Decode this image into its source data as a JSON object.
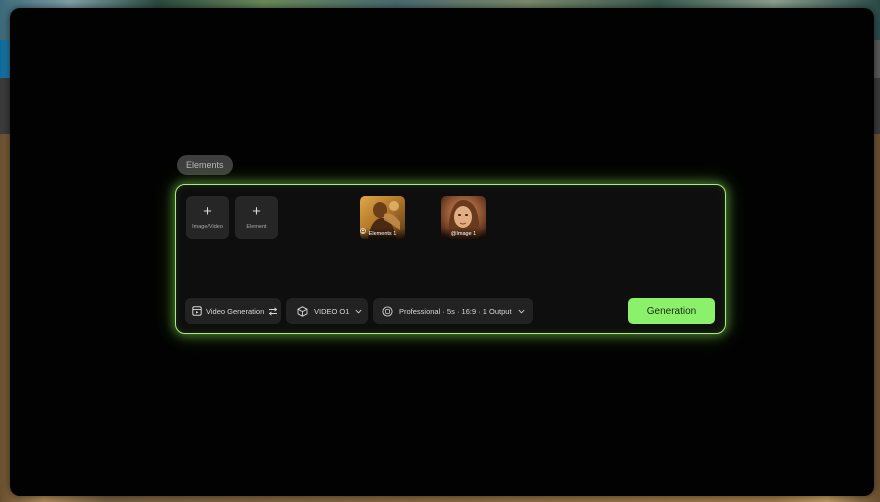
{
  "tag": {
    "label": "Elements"
  },
  "uploads": [
    {
      "label": "Image/Video",
      "icon": "plus-icon"
    },
    {
      "label": "Element",
      "icon": "plus-icon"
    }
  ],
  "thumbnails": [
    {
      "label": "Elements 1",
      "icon": "person-badge-icon"
    },
    {
      "label": "@Image 1"
    }
  ],
  "toolbar": {
    "mode": {
      "label": "Video Generation",
      "icon": "video-frame-icon",
      "trailing_icon": "swap-arrows-icon"
    },
    "model": {
      "label": "VIDEO O1",
      "icon": "cube-icon",
      "trailing_icon": "chevron-down-icon"
    },
    "settings": {
      "label": "Professional · 5s · 16:9 · 1 Output",
      "icon": "settings-circle-icon",
      "trailing_icon": "chevron-down-icon"
    },
    "generate": {
      "label": "Generation"
    }
  },
  "colors": {
    "accent": "#8cf16a",
    "glow_border": "#a6f07a",
    "panel": "#0e0e0e",
    "window": "#020202"
  }
}
